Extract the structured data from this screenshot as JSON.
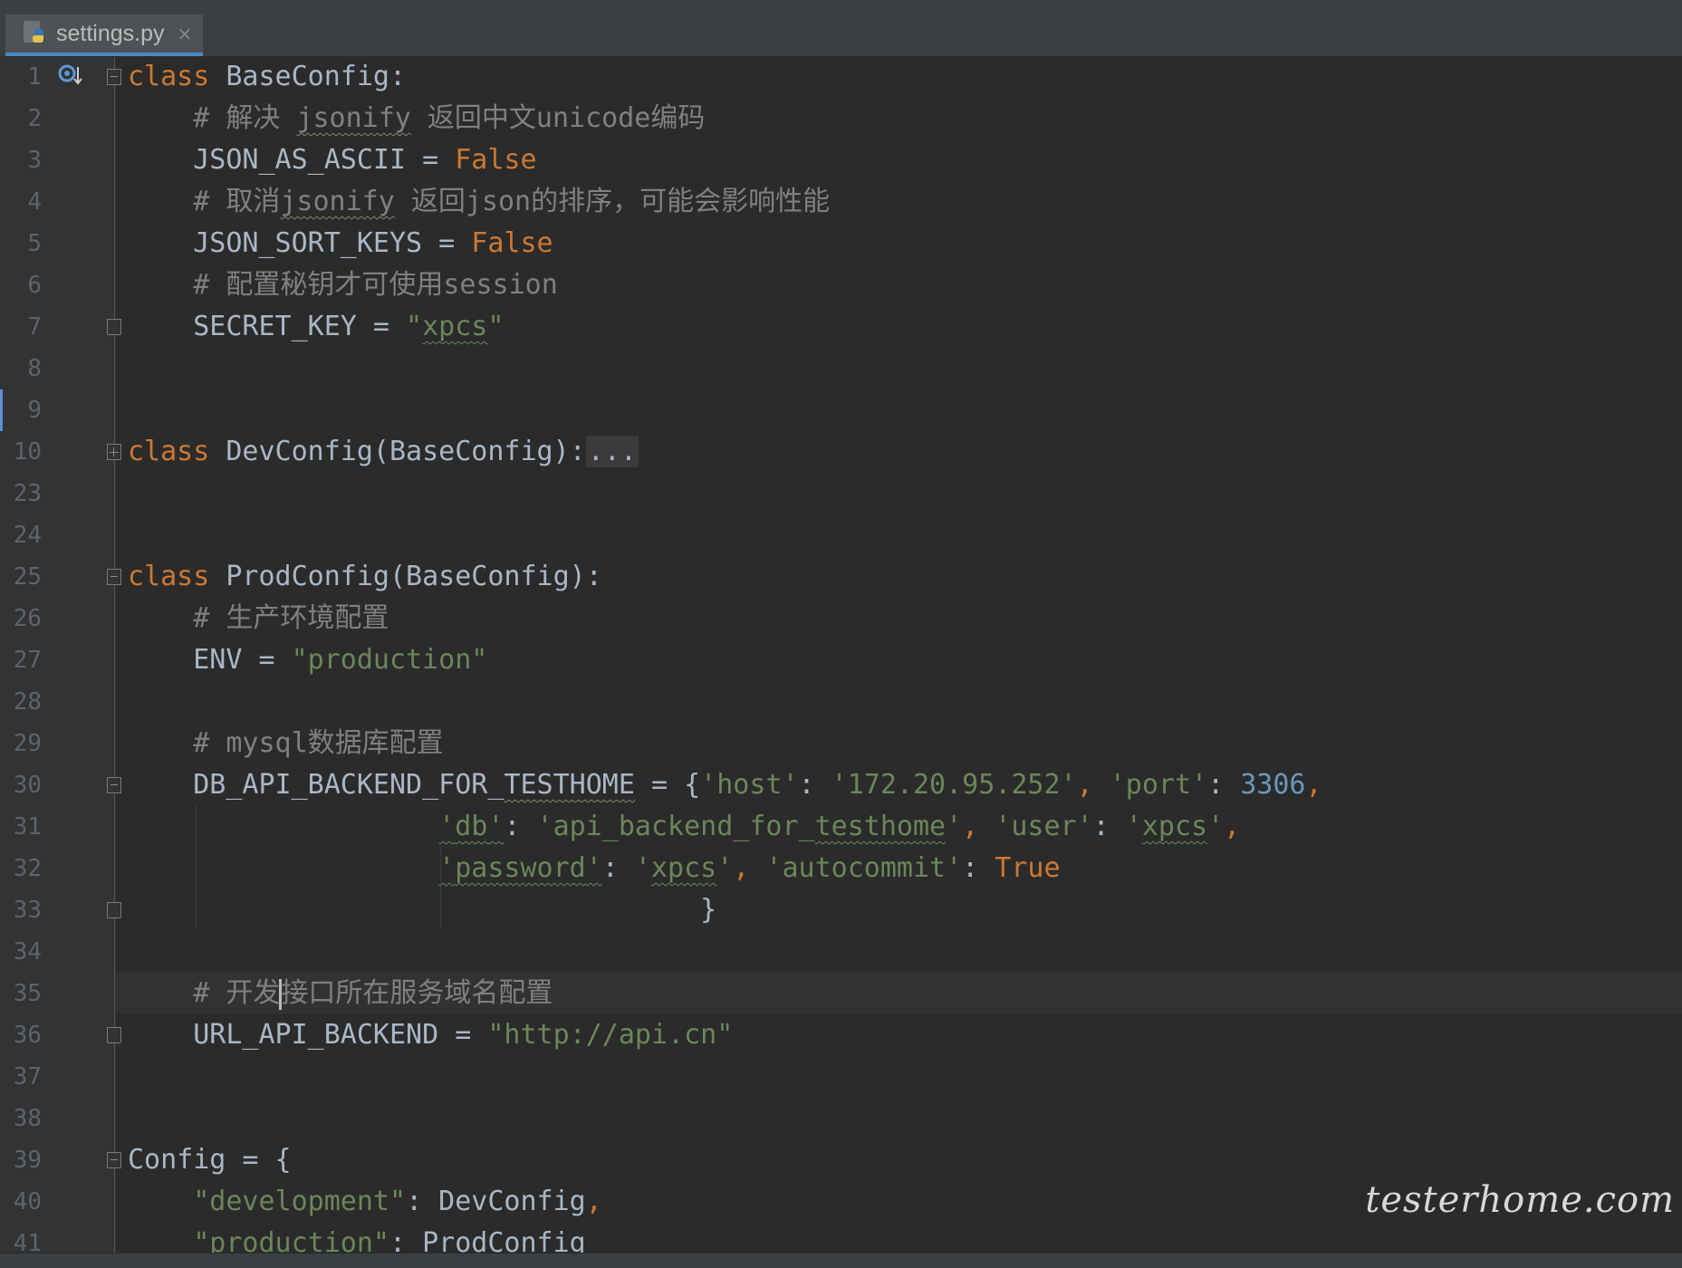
{
  "tab": {
    "label": "settings.py",
    "close": "×",
    "icon": "python-file-icon"
  },
  "lines": [
    {
      "n": "1"
    },
    {
      "n": "2"
    },
    {
      "n": "3"
    },
    {
      "n": "4"
    },
    {
      "n": "5"
    },
    {
      "n": "6"
    },
    {
      "n": "7"
    },
    {
      "n": "8"
    },
    {
      "n": "9"
    },
    {
      "n": "10"
    },
    {
      "n": "23"
    },
    {
      "n": "24"
    },
    {
      "n": "25"
    },
    {
      "n": "26"
    },
    {
      "n": "27"
    },
    {
      "n": "28"
    },
    {
      "n": "29"
    },
    {
      "n": "30"
    },
    {
      "n": "31"
    },
    {
      "n": "32"
    },
    {
      "n": "33"
    },
    {
      "n": "34"
    },
    {
      "n": "35"
    },
    {
      "n": "36"
    },
    {
      "n": "37"
    },
    {
      "n": "38"
    },
    {
      "n": "39"
    },
    {
      "n": "40"
    },
    {
      "n": "41"
    }
  ],
  "code": {
    "l1": {
      "kw": "class",
      "name": " BaseConfig:"
    },
    "l2": {
      "a": "    # 解决 ",
      "b": "jsonify",
      "c": " 返回中文unicode编码"
    },
    "l3": {
      "a": "    JSON_AS_ASCII = ",
      "b": "False"
    },
    "l4": {
      "a": "    # 取消",
      "b": "jsonify",
      "c": " 返回json的排序，可能会影响性能"
    },
    "l5": {
      "a": "    JSON_SORT_KEYS = ",
      "b": "False"
    },
    "l6": {
      "a": "    # 配置秘钥才可使用session"
    },
    "l7": {
      "a": "    SECRET_KEY = ",
      "q1": "\"",
      "b": "xpcs",
      "q2": "\""
    },
    "l10": {
      "kw": "class",
      "name": " DevConfig(BaseConfig):",
      "fold": "..."
    },
    "l25": {
      "kw": "class",
      "name": " ProdConfig(BaseConfig):"
    },
    "l26": {
      "a": "    # 生产环境配置"
    },
    "l27": {
      "a": "    ENV = ",
      "b": "\"production\""
    },
    "l29": {
      "a": "    # mysql数据库配置"
    },
    "l30": {
      "pre": "    DB_API_BACKEND_FOR_",
      "sq": "TESTHOME",
      "eq": " = {",
      "k1": "'host'",
      "c1": ": ",
      "v1": "'172.20.95.252'",
      "cm1": ", ",
      "k2": "'port'",
      "c2": ": ",
      "num": "3306",
      "cm2": ","
    },
    "l31": {
      "pad": "                   ",
      "k1a": "'",
      "k1b": "db",
      "k1c": "'",
      "c1": ": ",
      "v1a": "'api_backend_for_",
      "v1b": "testhome",
      "v1c": "'",
      "cm1": ", ",
      "k2": "'user'",
      "c2": ": ",
      "v2a": "'",
      "v2b": "xpcs",
      "v2c": "'",
      "cm2": ","
    },
    "l32": {
      "pad": "                   ",
      "k1a": "'",
      "k1b": "password",
      "k1c": "'",
      "c1": ": ",
      "v1a": "'",
      "v1b": "xpcs",
      "v1c": "'",
      "cm1": ", ",
      "k2": "'autocommit'",
      "c2": ": ",
      "kw": "True"
    },
    "l33": {
      "a": "                                   }"
    },
    "l35": {
      "a": "    # 开发",
      "b": "接口所在服务域名配置"
    },
    "l36": {
      "a": "    URL_API_BACKEND = ",
      "b": "\"http://api.cn\""
    },
    "l39": {
      "a": "Config = {"
    },
    "l40": {
      "pad": "    ",
      "s": "\"development\"",
      "b": ": DevConfig",
      "c": ","
    },
    "l41": {
      "pad": "    ",
      "s": "\"production\"",
      "b": ": ProdConfig"
    }
  },
  "watermark": "testerhome.com",
  "colors": {
    "keyword": "#cc7832",
    "string": "#6a8759",
    "comment": "#808080",
    "number": "#6897bb",
    "identifier": "#a9b7c6",
    "background": "#2b2b2b"
  }
}
